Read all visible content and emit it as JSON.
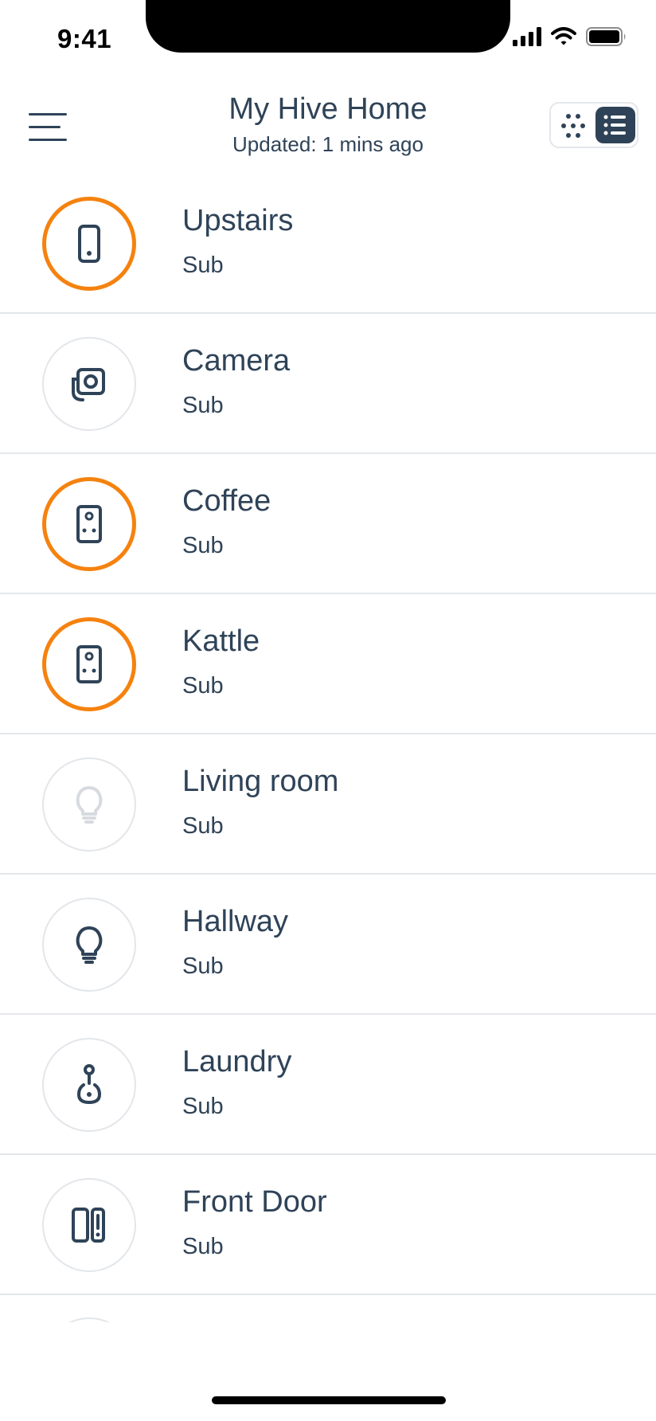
{
  "status_bar": {
    "time": "9:41"
  },
  "header": {
    "title": "My Hive Home",
    "subtitle": "Updated: 1 mins ago",
    "view_toggle": {
      "selected": "list"
    }
  },
  "colors": {
    "accent": "#f5820f",
    "text": "#2f4358",
    "border": "#e3e6ea"
  },
  "devices": [
    {
      "name": "Upstairs",
      "sub": "Sub",
      "icon": "phone-icon",
      "active": true
    },
    {
      "name": "Camera",
      "sub": "Sub",
      "icon": "camera-icon",
      "active": false
    },
    {
      "name": "Coffee",
      "sub": "Sub",
      "icon": "plug-icon",
      "active": true
    },
    {
      "name": "Kattle",
      "sub": "Sub",
      "icon": "plug-icon",
      "active": true
    },
    {
      "name": "Living room",
      "sub": "Sub",
      "icon": "bulb-icon",
      "active": false,
      "dimmed": true
    },
    {
      "name": "Hallway",
      "sub": "Sub",
      "icon": "bulb-icon",
      "active": false
    },
    {
      "name": "Laundry",
      "sub": "Sub",
      "icon": "sensor-icon",
      "active": false
    },
    {
      "name": "Front Door",
      "sub": "Sub",
      "icon": "door-sensor-icon",
      "active": false
    }
  ]
}
